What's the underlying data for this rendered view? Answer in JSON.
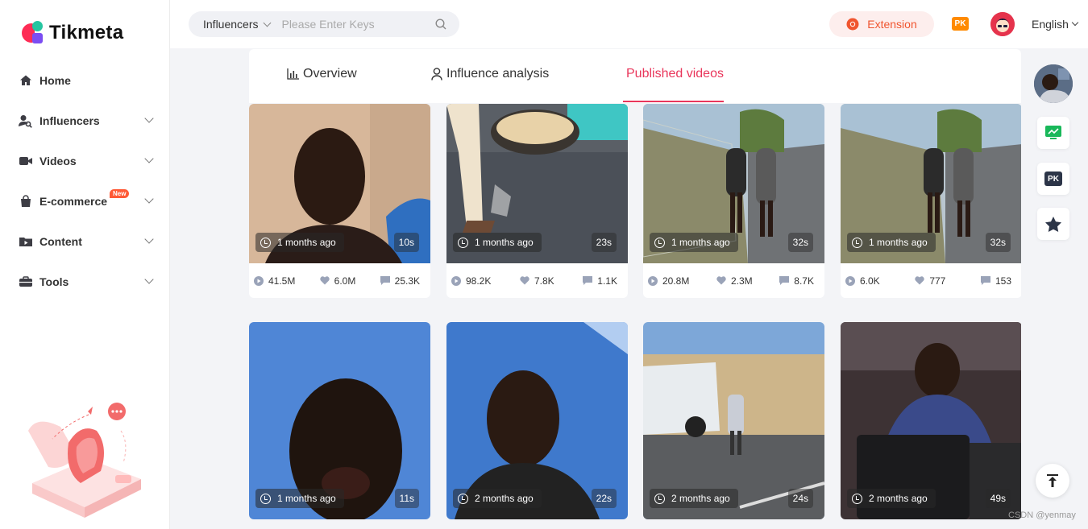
{
  "brand": {
    "name": "Tikmeta"
  },
  "sidebar": {
    "items": [
      {
        "label": "Home",
        "icon": "home-icon",
        "chevron": false
      },
      {
        "label": "Influencers",
        "icon": "user-search-icon",
        "chevron": true
      },
      {
        "label": "Videos",
        "icon": "video-icon",
        "chevron": true
      },
      {
        "label": "E-commerce",
        "icon": "shopping-bag-icon",
        "chevron": true,
        "badge": "New"
      },
      {
        "label": "Content",
        "icon": "folder-play-icon",
        "chevron": true
      },
      {
        "label": "Tools",
        "icon": "toolbox-icon",
        "chevron": true
      }
    ]
  },
  "header": {
    "search_scope": "Influencers",
    "search_placeholder": "Please Enter Keys",
    "extension_label": "Extension",
    "pk_label": "PK",
    "language": "English"
  },
  "tabs": [
    {
      "label": "Overview",
      "icon": "bar-chart-icon",
      "active": false
    },
    {
      "label": "Influence analysis",
      "icon": "user-icon",
      "active": false
    },
    {
      "label": "Published videos",
      "icon": "",
      "active": true
    }
  ],
  "videos": [
    {
      "time": "1 months ago",
      "duration": "10s",
      "plays": "41.5M",
      "likes": "6.0M",
      "comments": "25.3K"
    },
    {
      "time": "1 months ago",
      "duration": "23s",
      "plays": "98.2K",
      "likes": "7.8K",
      "comments": "1.1K"
    },
    {
      "time": "1 months ago",
      "duration": "32s",
      "plays": "20.8M",
      "likes": "2.3M",
      "comments": "8.7K"
    },
    {
      "time": "1 months ago",
      "duration": "32s",
      "plays": "6.0K",
      "likes": "777",
      "comments": "153"
    },
    {
      "time": "1 months ago",
      "duration": "11s"
    },
    {
      "time": "2 months ago",
      "duration": "22s"
    },
    {
      "time": "2 months ago",
      "duration": "24s"
    },
    {
      "time": "2 months ago",
      "duration": "49s"
    }
  ],
  "float": {
    "pk_label": "PK"
  },
  "watermark": "CSDN @yenmay",
  "colors": {
    "accent": "#e9365b",
    "extension": "#f0552f",
    "pk": "#ff8a00",
    "badge": "#ff5a36"
  }
}
